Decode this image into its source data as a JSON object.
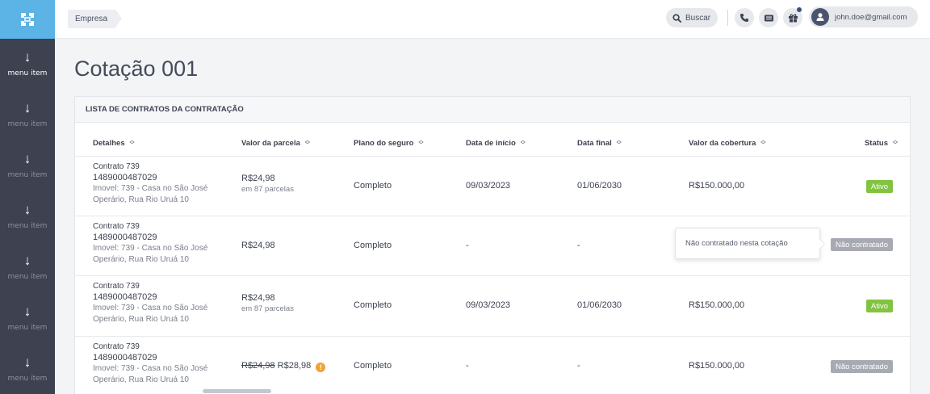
{
  "sidebar": {
    "items": [
      {
        "label": "menu item"
      },
      {
        "label": "menu item"
      },
      {
        "label": "menu item"
      },
      {
        "label": "menu item"
      },
      {
        "label": "menu item"
      },
      {
        "label": "menu item"
      },
      {
        "label": "menu item"
      }
    ],
    "logo_color": "#5bb3e6",
    "bg_color": "#3d4150"
  },
  "topbar": {
    "breadcrumb": "Empresa",
    "search_label": "Buscar",
    "user_email": "john.doe@gmail.com",
    "icons": [
      "search-icon",
      "phone-icon",
      "ticket-icon",
      "gift-icon",
      "user-icon"
    ]
  },
  "page": {
    "title": "Cotação 001"
  },
  "table": {
    "section_title": "LISTA DE CONTRATOS DA CONTRATAÇÃO",
    "headers": {
      "detalhes": "Detalhes",
      "valor_parcela": "Valor da parcela",
      "plano": "Plano do seguro",
      "data_inicio": "Data de início",
      "data_final": "Data final",
      "valor_cobertura": "Valor da cobertura",
      "status": "Status"
    },
    "rows": [
      {
        "contrato": "Contrato 739",
        "numero": "1489000487029",
        "imovel": "Imovel: 739 - Casa no São José",
        "endereco": "Operário, Rua Rio Uruá 10",
        "valor": "R$24,98",
        "valor_old": "",
        "parcelas": "em 87 parcelas",
        "plano": "Completo",
        "inicio": "09/03/2023",
        "final": "01/06/2030",
        "cobertura": "R$150.000,00",
        "status": "Ativo"
      },
      {
        "contrato": "Contrato 739",
        "numero": "1489000487029",
        "imovel": "Imovel: 739 - Casa no São José",
        "endereco": "Operário, Rua Rio Uruá 10",
        "valor": "R$24,98",
        "valor_old": "",
        "parcelas": "",
        "plano": "Completo",
        "inicio": "-",
        "final": "-",
        "cobertura": "",
        "status": "Não contratado",
        "tooltip": "Não contratado nesta cotação"
      },
      {
        "contrato": "Contrato 739",
        "numero": "1489000487029",
        "imovel": "Imovel: 739 - Casa no São José",
        "endereco": "Operário, Rua Rio Uruá 10",
        "valor": "R$24,98",
        "valor_old": "",
        "parcelas": "em 87 parcelas",
        "plano": "Completo",
        "inicio": "09/03/2023",
        "final": "01/06/2030",
        "cobertura": "R$150.000,00",
        "status": "Ativo"
      },
      {
        "contrato": "Contrato 739",
        "numero": "1489000487029",
        "imovel": "Imovel: 739 - Casa no São José",
        "endereco": "Operário, Rua Rio Uruá 10",
        "valor": "R$28,98",
        "valor_old": "R$24,98",
        "parcelas": "",
        "plano": "Completo",
        "inicio": "-",
        "final": "-",
        "cobertura": "R$150.000,00",
        "status": "Não contratado"
      }
    ]
  },
  "colors": {
    "status_ativo": "#82c341",
    "status_nao_contratado": "#a7aab3",
    "warning": "#f0a23a"
  }
}
